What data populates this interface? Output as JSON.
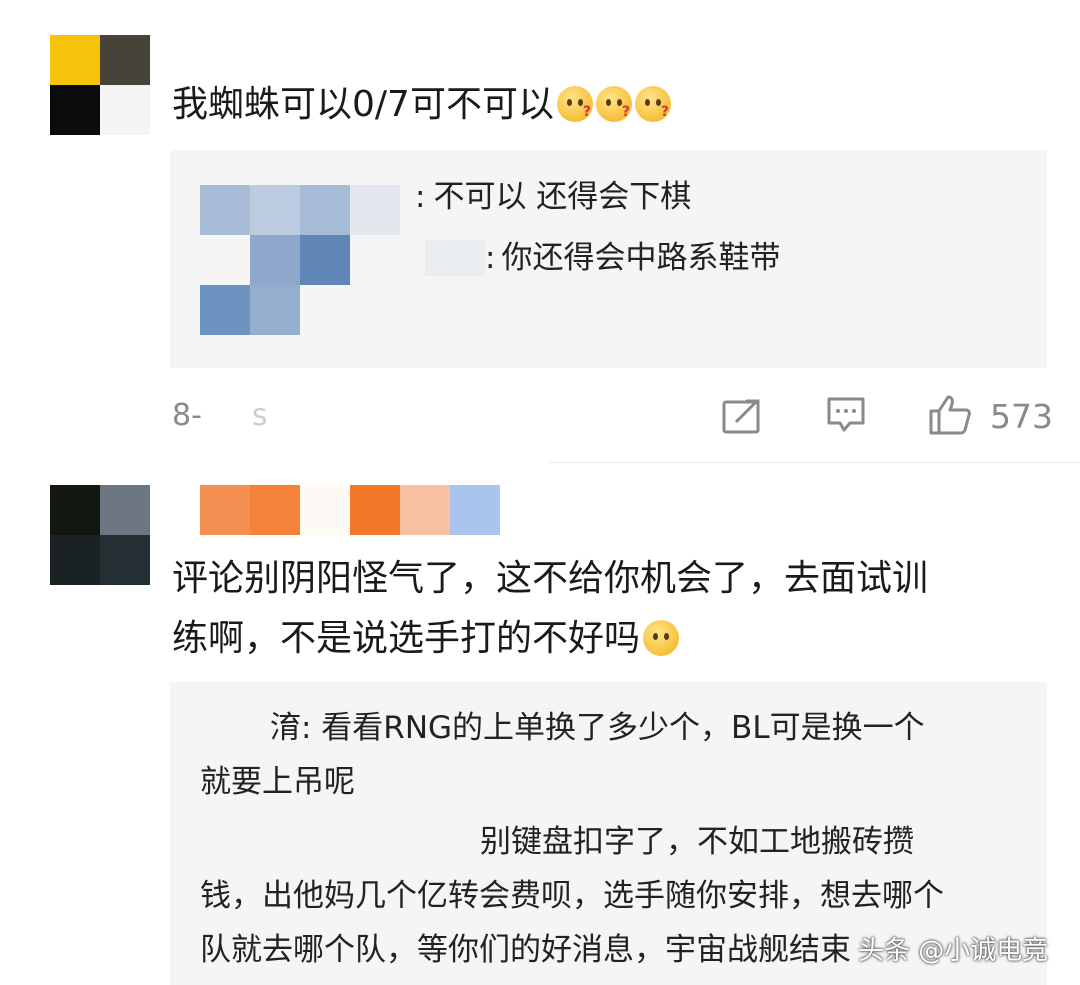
{
  "comment1": {
    "text": "我蜘蛛可以0/7可不可以",
    "emoji": [
      "confused-face-emoji",
      "confused-face-emoji",
      "confused-face-emoji"
    ],
    "replies": [
      {
        "prefix": ":",
        "text": "不可以  还得会下棋"
      },
      {
        "prefix": ":",
        "text": "你还得会中路系鞋带"
      }
    ],
    "meta_left": "8-",
    "meta_blur": "s",
    "like_count": "573",
    "icons": {
      "share": "share-icon",
      "reply": "comment-icon",
      "like": "thumbs-up-icon"
    }
  },
  "comment2": {
    "line1": "评论别阴阳怪气了，这不给你机会了，去面试训",
    "line2": "练啊，不是说选手打的不好吗",
    "emoji": [
      "shy-face-emoji"
    ],
    "replies": [
      {
        "line1": "淯: 看看RNG的上单换了多少个，BL可是换一个",
        "line2": "就要上吊呢"
      },
      {
        "line1": "别键盘扣字了，不如工地搬砖攒",
        "line2": "钱，出他妈几个亿转会费呗，选手随你安排，想去哪个",
        "line3": "队就去哪个队，等你们的好消息，宇宙战舰结束"
      }
    ]
  },
  "watermark": "头条 @小诚电竞",
  "colors": {
    "reply_bg": "#f5f5f5",
    "meta_gray": "#8a8a8a"
  }
}
